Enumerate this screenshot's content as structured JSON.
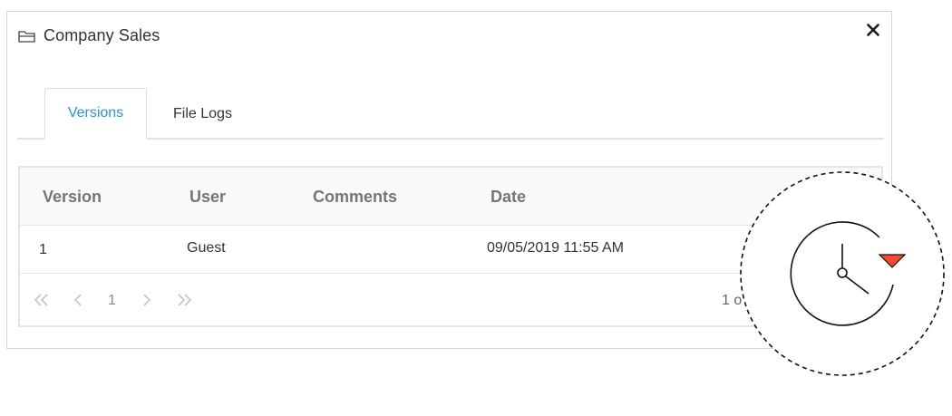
{
  "dialog": {
    "title": "Company Sales",
    "folder_icon": "folder-icon",
    "close_icon": "close-icon"
  },
  "tabs": [
    {
      "label": "Versions",
      "active": true
    },
    {
      "label": "File Logs",
      "active": false
    }
  ],
  "grid": {
    "columns": [
      "Version",
      "User",
      "Comments",
      "Date"
    ],
    "rows": [
      {
        "version": "1",
        "user": "Guest",
        "comments": "",
        "date": "09/05/2019 11:55 AM"
      }
    ]
  },
  "pager": {
    "current_page": "1",
    "info": "1 o"
  },
  "overlay": {
    "icon": "version-history-clock-icon",
    "accent_color": "#f04a2c"
  },
  "colors": {
    "active_tab": "#2f8fd8",
    "header_text": "#757575",
    "border": "#e4e4e4"
  }
}
